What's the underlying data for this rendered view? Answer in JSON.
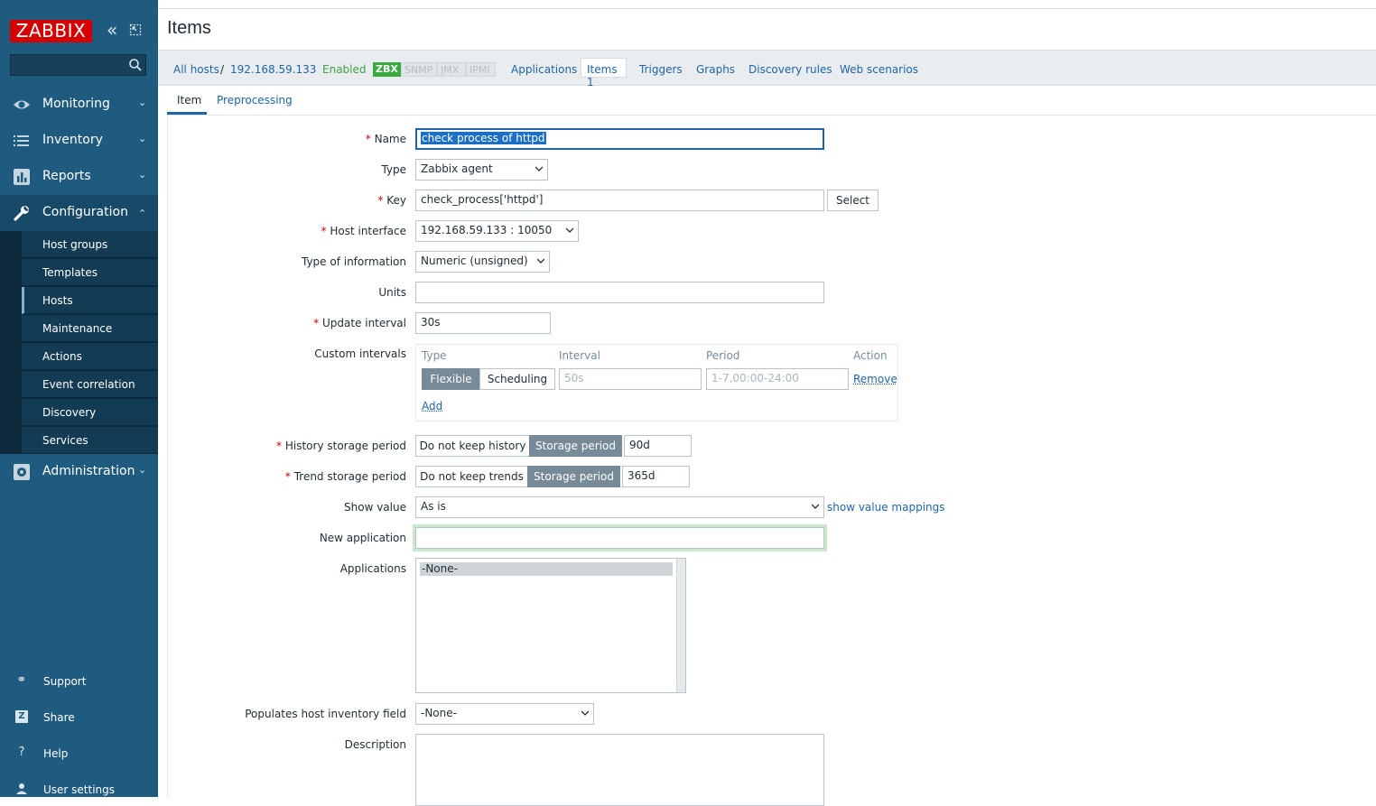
{
  "sidebar": {
    "logo": "ZABBIX",
    "search_placeholder": "",
    "menu": [
      {
        "label": "Monitoring",
        "icon": "eye-icon"
      },
      {
        "label": "Inventory",
        "icon": "list-icon"
      },
      {
        "label": "Reports",
        "icon": "bar-chart-icon"
      },
      {
        "label": "Configuration",
        "icon": "wrench-icon"
      },
      {
        "label": "Administration",
        "icon": "gear-icon"
      }
    ],
    "submenu": [
      "Host groups",
      "Templates",
      "Hosts",
      "Maintenance",
      "Actions",
      "Event correlation",
      "Discovery",
      "Services"
    ],
    "bottom": [
      {
        "label": "Support",
        "icon": "headset-icon"
      },
      {
        "label": "Share",
        "icon": "share-icon"
      },
      {
        "label": "Help",
        "icon": "help-icon"
      },
      {
        "label": "User settings",
        "icon": "user-icon"
      }
    ]
  },
  "header": {
    "title": "Items"
  },
  "host_nav": {
    "all_hosts": "All hosts",
    "separator": "/",
    "host": "192.168.59.133",
    "status": "Enabled",
    "badges": [
      "ZBX",
      "SNMP",
      "JMX",
      "IPMI"
    ],
    "links": [
      "Applications",
      "Items 1",
      "Triggers",
      "Graphs",
      "Discovery rules",
      "Web scenarios"
    ]
  },
  "form_tabs": [
    "Item",
    "Preprocessing"
  ],
  "form": {
    "name": {
      "label": "Name",
      "value": "check process of httpd"
    },
    "type": {
      "label": "Type",
      "value": "Zabbix agent"
    },
    "key": {
      "label": "Key",
      "value": "check_process['httpd']",
      "button": "Select"
    },
    "host_interface": {
      "label": "Host interface",
      "value": "192.168.59.133 : 10050"
    },
    "type_of_info": {
      "label": "Type of information",
      "value": "Numeric (unsigned)"
    },
    "units": {
      "label": "Units",
      "value": ""
    },
    "update_interval": {
      "label": "Update interval",
      "value": "30s"
    },
    "custom_intervals": {
      "label": "Custom intervals",
      "headers": [
        "Type",
        "Interval",
        "Period",
        "Action"
      ],
      "seg": [
        "Flexible",
        "Scheduling"
      ],
      "interval_placeholder": "50s",
      "period_placeholder": "1-7,00:00-24:00",
      "remove": "Remove",
      "add": "Add"
    },
    "history": {
      "label": "History storage period",
      "off": "Do not keep history",
      "on": "Storage period",
      "value": "90d"
    },
    "trends": {
      "label": "Trend storage period",
      "off": "Do not keep trends",
      "on": "Storage period",
      "value": "365d"
    },
    "show_value": {
      "label": "Show value",
      "value": "As is",
      "link": "show value mappings"
    },
    "new_application": {
      "label": "New application",
      "value": ""
    },
    "applications": {
      "label": "Applications",
      "options": [
        "-None-"
      ]
    },
    "inventory": {
      "label": "Populates host inventory field",
      "value": "-None-"
    },
    "description": {
      "label": "Description",
      "value": ""
    }
  },
  "colors": {
    "sidebar": "#1f5b7e",
    "accent": "#1f65a6",
    "logo": "#d40000",
    "enabled": "#429e47"
  }
}
